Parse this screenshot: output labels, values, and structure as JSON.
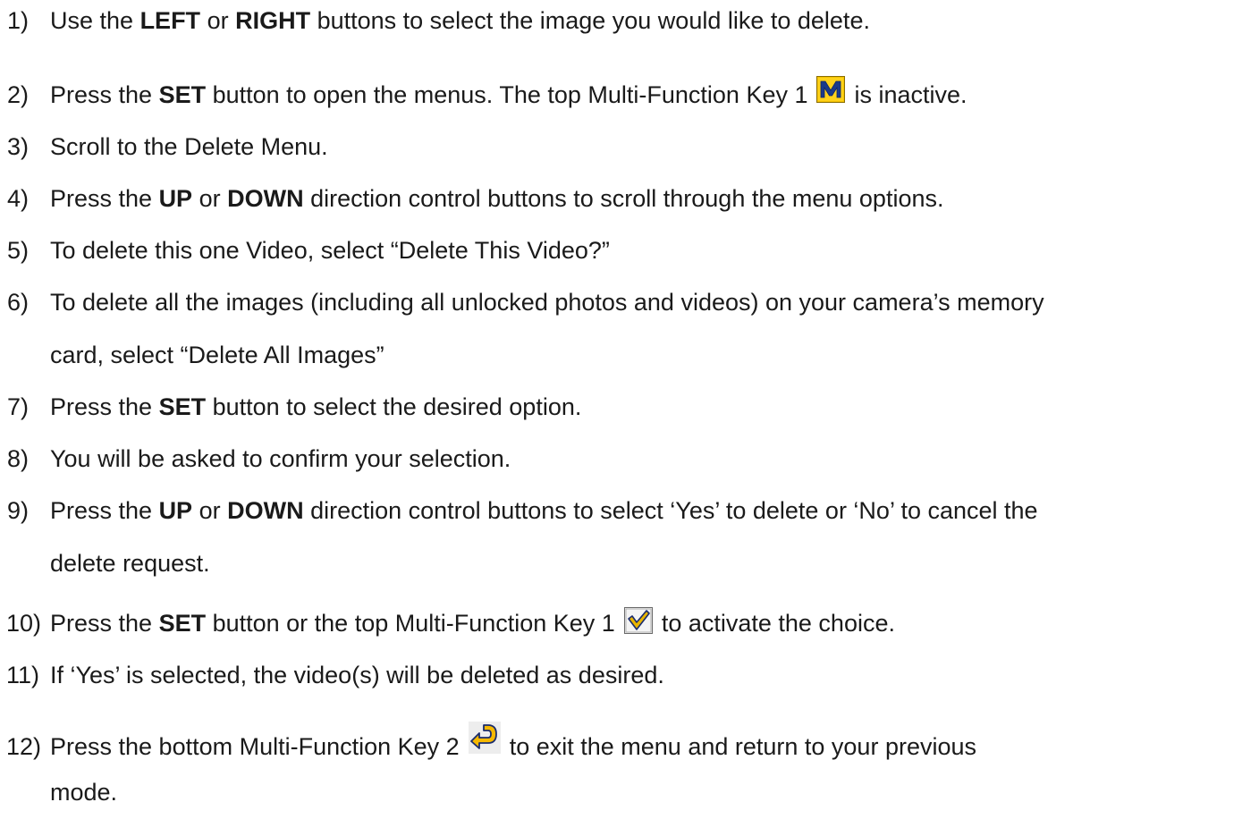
{
  "steps": [
    {
      "num": "1)",
      "parts": [
        "Use the ",
        "LEFT",
        " or ",
        "RIGHT",
        " buttons to select the image you would like to delete."
      ]
    },
    {
      "num": "2)",
      "parts": [
        "Press the ",
        "SET",
        " button to open the menus. The top Multi-Function Key 1",
        "is inactive."
      ]
    },
    {
      "num": "3)",
      "text": "Scroll to the Delete Menu."
    },
    {
      "num": "4)",
      "parts": [
        "Press the ",
        "UP",
        " or ",
        "DOWN",
        " direction control buttons to scroll through the menu options."
      ]
    },
    {
      "num": "5)",
      "text": "To delete this one Video, select “Delete This Video?”"
    },
    {
      "num": "6)",
      "line1": "To delete all the images (including all unlocked photos and videos) on your camera’s memory",
      "line2": "card, select “Delete All Images”"
    },
    {
      "num": "7)",
      "parts": [
        "Press the ",
        "SET",
        " button to select the desired option."
      ]
    },
    {
      "num": "8)",
      "text": "You will be asked to confirm your selection."
    },
    {
      "num": "9)",
      "parts": [
        "Press the ",
        "UP",
        " or ",
        "DOWN",
        " direction control buttons to select ‘Yes’ to delete or ‘No’ to cancel the"
      ],
      "line2": "delete request."
    },
    {
      "num": "10)",
      "parts": [
        "Press the ",
        "SET",
        " button or the top Multi-Function Key 1",
        "to activate the choice."
      ]
    },
    {
      "num": "11)",
      "text": "If ‘Yes’ is selected, the video(s) will be deleted as desired."
    },
    {
      "num": "12)",
      "parts": [
        "Press the bottom Multi-Function Key 2",
        "to exit the menu and return to your previous"
      ],
      "line2": "mode."
    }
  ],
  "icons": {
    "menu_icon": "menu-m-icon",
    "check_icon": "checkmark-icon",
    "return_icon": "return-arrow-icon"
  },
  "colors": {
    "m_icon_bg": "#f5c400",
    "m_icon_letter": "#1a3a8a",
    "check_bg": "#f0f0f0",
    "check_mark": "#d4a000",
    "return_arrow": "#f0b800"
  }
}
